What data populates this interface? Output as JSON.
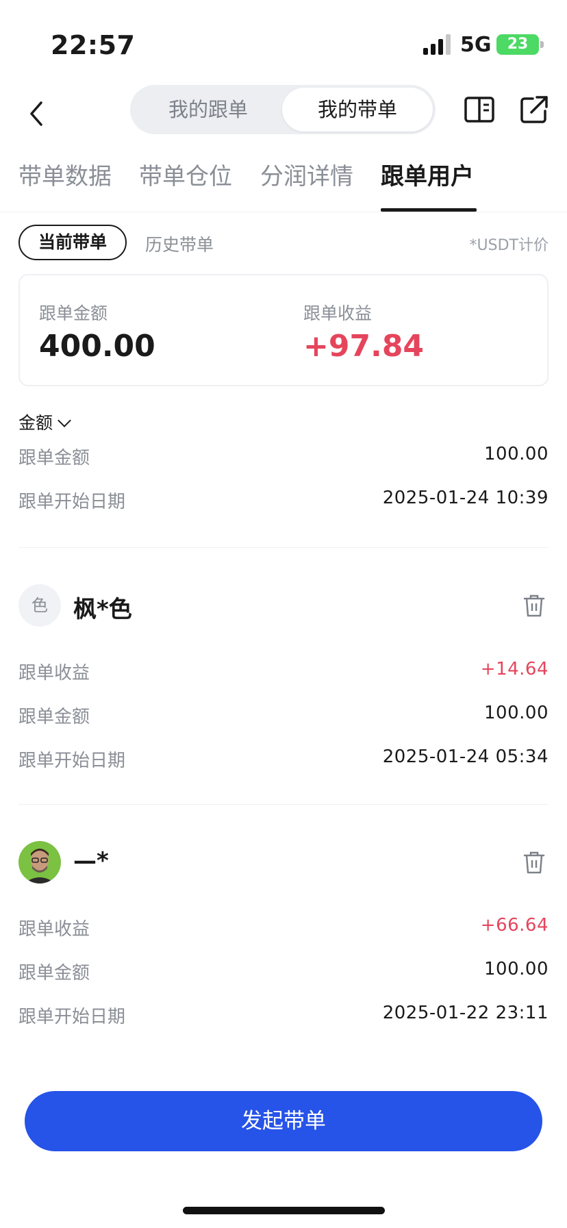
{
  "status_bar": {
    "time": "22:57",
    "network": "5G",
    "battery": "23"
  },
  "header": {
    "segments": [
      "我的跟单",
      "我的带单"
    ],
    "active_segment": "我的带单",
    "icons": [
      "back-icon",
      "book-icon",
      "share-icon"
    ]
  },
  "tabs": [
    "带单数据",
    "带单仓位",
    "分润详情",
    "跟单用户"
  ],
  "active_tab": "跟单用户",
  "filters": {
    "current": "当前带单",
    "history": "历史带单",
    "unit_note": "*USDT计价"
  },
  "summary": {
    "amount_label": "跟单金额",
    "amount_value": "400.00",
    "profit_label": "跟单收益",
    "profit_value": "+97.84"
  },
  "sort_label": "金额",
  "first_partial": {
    "amount_label": "跟单金额",
    "amount_value": "100.00",
    "date_label": "跟单开始日期",
    "date_value": "2025-01-24 10:39"
  },
  "users": [
    {
      "avatar_text": "色",
      "name": "枫*色",
      "profit_label": "跟单收益",
      "profit": "+14.64",
      "amount_label": "跟单金额",
      "amount": "100.00",
      "date_label": "跟单开始日期",
      "date": "2025-01-24 05:34"
    },
    {
      "name": "—*",
      "profit_label": "跟单收益",
      "profit": "+66.64",
      "amount_label": "跟单金额",
      "amount": "100.00",
      "date_label": "跟单开始日期",
      "date": "2025-01-22 23:11"
    }
  ],
  "cta_label": "发起带单",
  "colors": {
    "positive": "#e5455c",
    "primary": "#2653e8",
    "battery": "#4cd964"
  }
}
